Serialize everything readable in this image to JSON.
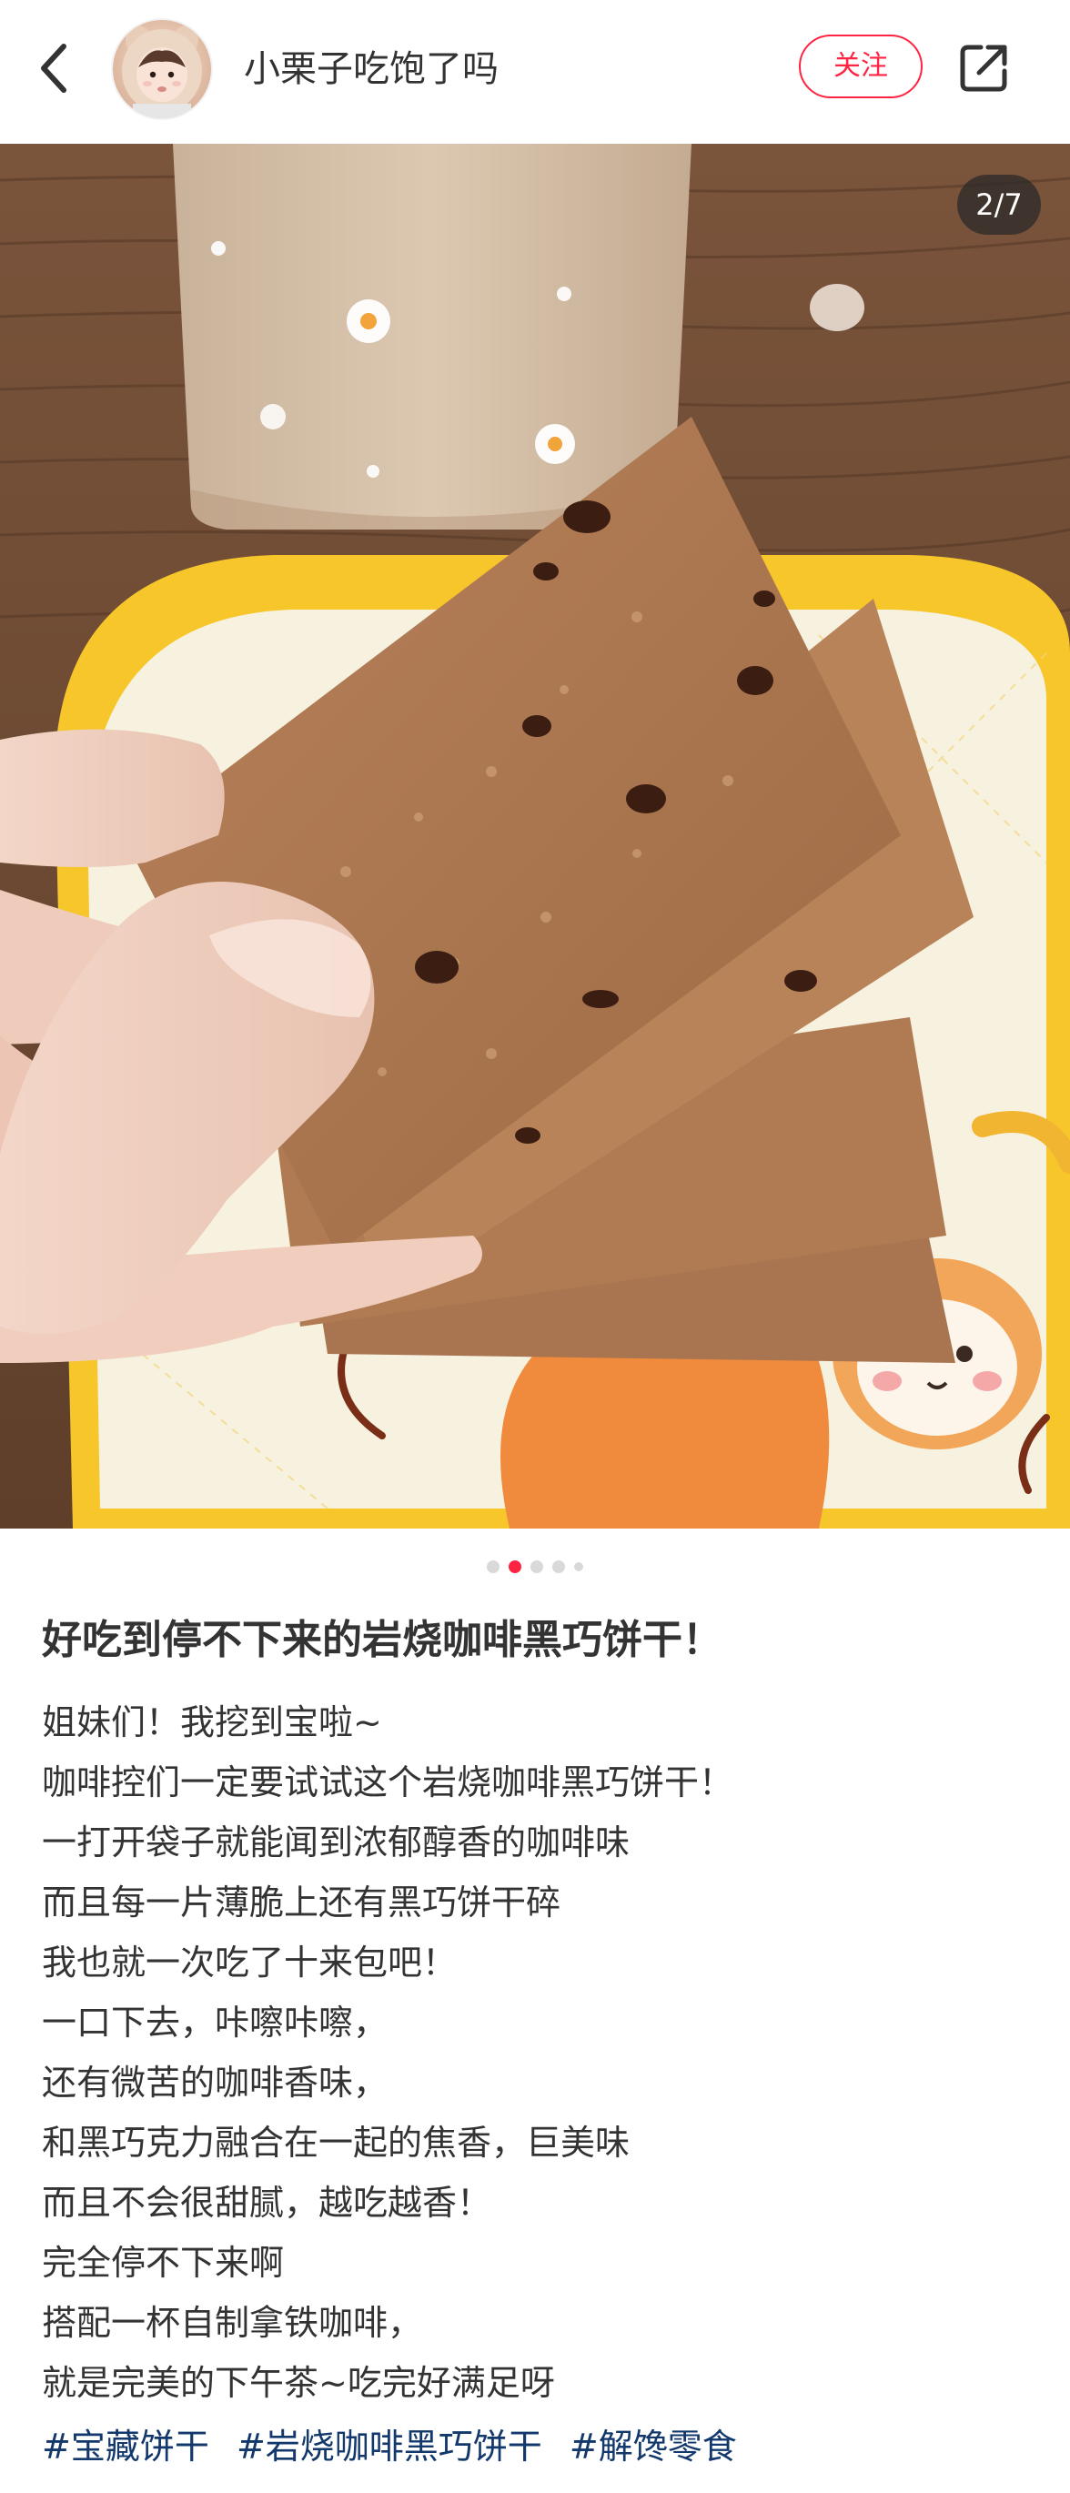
{
  "header": {
    "author_name": "小栗子吃饱了吗",
    "follow_label": "关注"
  },
  "photo": {
    "counter": "2/7",
    "current_page": 2,
    "total_pages": 7
  },
  "colors": {
    "accent": "#ff2442",
    "tag": "#13386c",
    "text": "#333333"
  },
  "icons": {
    "back": "back-arrow-icon",
    "share": "share-icon"
  },
  "note": {
    "title": "好吃到停不下来的岩烧咖啡黑巧饼干！",
    "lines": [
      "姐妹们！我挖到宝啦~",
      "咖啡控们一定要试试这个岩烧咖啡黑巧饼干！",
      "一打开袋子就能闻到浓郁醇香的咖啡味",
      "而且每一片薄脆上还有黑巧饼干碎",
      "我也就一次吃了十来包吧！",
      "一口下去，咔嚓咔嚓，",
      "还有微苦的咖啡香味，",
      "和黑巧克力融合在一起的焦香，巨美味",
      "而且不会很甜腻，越吃越香！",
      "完全停不下来啊",
      "搭配一杯自制拿铁咖啡，",
      "就是完美的下午茶~吃完好满足呀"
    ],
    "tags": [
      "#宝藏饼干",
      "#岩烧咖啡黑巧饼干",
      "#解馋零食"
    ]
  }
}
